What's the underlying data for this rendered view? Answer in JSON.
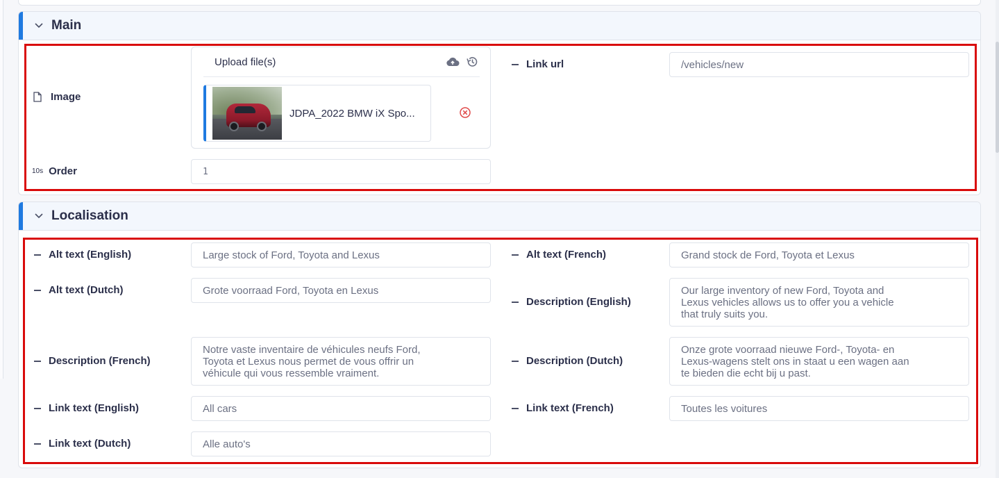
{
  "main": {
    "title": "Main",
    "image_label": "Image",
    "upload_title": "Upload file(s)",
    "file_name": "JDPA_2022 BMW iX Spo...",
    "order_icon_text": "10s",
    "order_label": "Order",
    "order_value": "1",
    "link_url_label": "Link url",
    "link_url_value": "/vehicles/new"
  },
  "localisation": {
    "title": "Localisation",
    "alt_en_label": "Alt text (English)",
    "alt_en_value": "Large stock of Ford, Toyota and Lexus",
    "alt_fr_label": "Alt text (French)",
    "alt_fr_value": "Grand stock de Ford, Toyota et Lexus",
    "alt_nl_label": "Alt text (Dutch)",
    "alt_nl_value": "Grote voorraad Ford, Toyota en Lexus",
    "desc_en_label": "Description (English)",
    "desc_en_value": "Our large inventory of new Ford, Toyota and\nLexus vehicles allows us to offer you a vehicle\nthat truly suits you.",
    "desc_fr_label": "Description (French)",
    "desc_fr_value": "Notre vaste inventaire de véhicules neufs Ford,\nToyota et Lexus nous permet de vous offrir un\nvéhicule qui vous ressemble vraiment.",
    "desc_nl_label": "Description (Dutch)",
    "desc_nl_value": "Onze grote voorraad nieuwe Ford-, Toyota- en\nLexus-wagens stelt ons in staat u een wagen aan\nte bieden die echt bij u past.",
    "link_en_label": "Link text (English)",
    "link_en_value": "All cars",
    "link_fr_label": "Link text (French)",
    "link_fr_value": "Toutes les voitures",
    "link_nl_label": "Link text (Dutch)",
    "link_nl_value": "Alle auto's"
  },
  "icons": {
    "chevron": "chevron-down-icon",
    "file": "file-icon",
    "upload": "cloud-upload-icon",
    "history": "history-icon",
    "remove": "remove-circle-icon"
  },
  "colors": {
    "accent": "#1f7ae0",
    "highlight": "#d90b0b",
    "remove": "#e04a4a"
  }
}
